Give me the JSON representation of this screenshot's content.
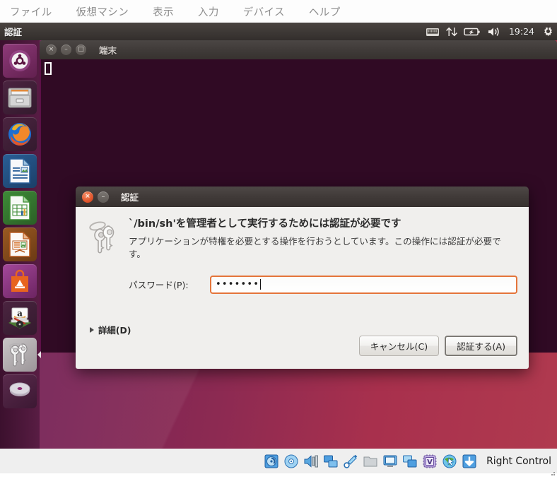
{
  "vbox": {
    "menubar": [
      {
        "label": "ファイル",
        "name": "menu-file"
      },
      {
        "label": "仮想マシン",
        "name": "menu-machine"
      },
      {
        "label": "表示",
        "name": "menu-view"
      },
      {
        "label": "入力",
        "name": "menu-input"
      },
      {
        "label": "デバイス",
        "name": "menu-devices"
      },
      {
        "label": "ヘルプ",
        "name": "menu-help"
      }
    ],
    "statusbar": {
      "host_key_label": "Right Control",
      "icons": [
        "hard-disk-icon",
        "optical-disk-icon",
        "audio-icon",
        "network-icon",
        "usb-icon",
        "shared-folder-icon",
        "display-icon",
        "screen-capture-icon",
        "virtualization-icon",
        "mouse-integration-icon",
        "keyboard-capture-icon"
      ]
    }
  },
  "ubuntu_panel": {
    "title": "認証",
    "clock": "19:24",
    "indicators": [
      "keyboard-indicator-icon",
      "network-indicator-icon",
      "battery-indicator-icon",
      "volume-indicator-icon",
      "session-gear-icon"
    ]
  },
  "launcher": {
    "items": [
      {
        "name": "launcher-item-dash",
        "icon": "ubuntu-dash-icon",
        "running": false
      },
      {
        "name": "launcher-item-files",
        "icon": "files-icon",
        "running": false
      },
      {
        "name": "launcher-item-firefox",
        "icon": "firefox-icon",
        "running": false
      },
      {
        "name": "launcher-item-writer",
        "icon": "libreoffice-writer-icon",
        "running": false
      },
      {
        "name": "launcher-item-calc",
        "icon": "libreoffice-calc-icon",
        "running": false
      },
      {
        "name": "launcher-item-impress",
        "icon": "libreoffice-impress-icon",
        "running": false
      },
      {
        "name": "launcher-item-software",
        "icon": "ubuntu-software-icon",
        "running": false
      },
      {
        "name": "launcher-item-amazon",
        "icon": "amazon-icon",
        "running": false
      },
      {
        "name": "launcher-item-passwords",
        "icon": "keys-icon",
        "running": true
      },
      {
        "name": "launcher-item-disc",
        "icon": "optical-disc-icon",
        "running": false
      }
    ]
  },
  "terminal": {
    "title": "端末",
    "buttons": {
      "close": "×",
      "minimize": "–",
      "maximize": "□"
    }
  },
  "auth_dialog": {
    "title": "認証",
    "close_glyph": "×",
    "minimize_glyph": "–",
    "heading": "`/bin/sh'を管理者として実行するためには認証が必要です",
    "description": "アプリケーションが特権を必要とする操作を行おうとしています。この操作には認証が必要です。",
    "password_label": "パスワード(P):",
    "password_value": "•••••••",
    "details_label": "詳細(D)",
    "cancel_label": "キャンセル(C)",
    "authenticate_label": "認証する(A)"
  },
  "colors": {
    "accent_orange": "#e4743a",
    "terminal_bg": "#300a24",
    "panel_bg": "#3d3835",
    "dialog_bg": "#f0efed"
  }
}
